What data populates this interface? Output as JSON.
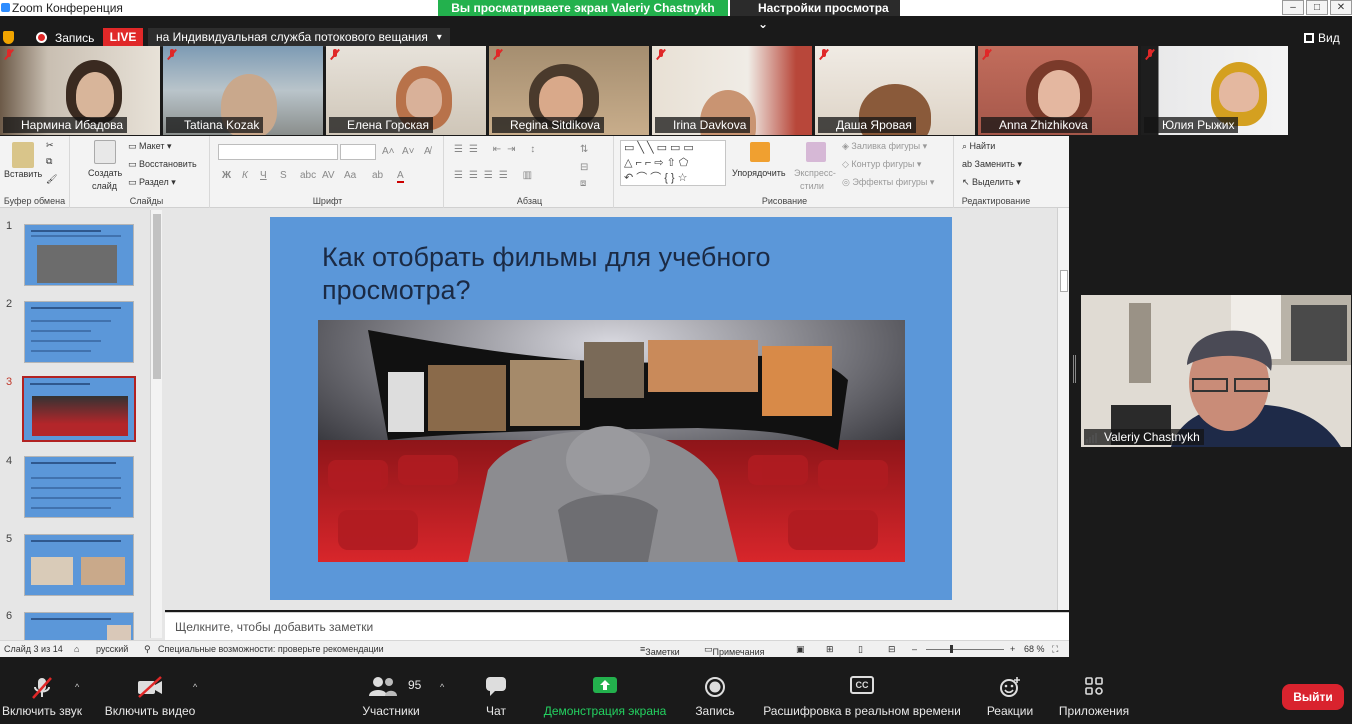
{
  "window": {
    "title": "Zoom Конференция",
    "share_banner": "Вы просматриваете экран Valeriy Chastnykh",
    "view_options": "Настройки просмотра"
  },
  "status": {
    "recording": "Запись",
    "live": "LIVE",
    "live_target": "на Индивидуальная служба потокового вещания",
    "view": "Вид"
  },
  "participants": [
    {
      "name": "Нармина Ибадова"
    },
    {
      "name": "Tatiana Kozak"
    },
    {
      "name": "Елена Горская"
    },
    {
      "name": "Regina Sitdikova"
    },
    {
      "name": "Irina Davkova"
    },
    {
      "name": "Даша Яровая"
    },
    {
      "name": "Anna Zhizhikova"
    },
    {
      "name": "Юлия Рыжих"
    }
  ],
  "active_speaker": {
    "name": "Valeriy Chastnykh"
  },
  "ribbon": {
    "groups": {
      "clipboard": "Буфер обмена",
      "slides": "Слайды",
      "font": "Шрифт",
      "paragraph": "Абзац",
      "drawing": "Рисование",
      "editing": "Редактирование"
    },
    "paste": "Вставить",
    "new_slide_1": "Создать",
    "new_slide_2": "слайд",
    "layout": "Макет",
    "reset": "Восстановить",
    "section": "Раздел",
    "arrange": "Упорядочить",
    "quick_styles_1": "Экспресс-",
    "quick_styles_2": "стили",
    "shape_fill": "Заливка фигуры",
    "shape_outline": "Контур фигуры",
    "shape_effects": "Эффекты фигуры",
    "find": "Найти",
    "replace": "Заменить",
    "select": "Выделить",
    "bold": "Ж",
    "italic": "К",
    "underline": "Ч",
    "strike": "S",
    "spacing": "AV",
    "case": "Aa",
    "font_color": "A"
  },
  "thumbnails": [
    {
      "num": "1"
    },
    {
      "num": "2"
    },
    {
      "num": "3"
    },
    {
      "num": "4"
    },
    {
      "num": "5"
    },
    {
      "num": "6"
    }
  ],
  "slide": {
    "title": "Как отобрать фильмы для учебного просмотра?"
  },
  "notes_placeholder": "Щелкните, чтобы добавить заметки",
  "ppt_status": {
    "slide_count": "Слайд 3 из 14",
    "language": "русский",
    "accessibility": "Специальные возможности: проверьте рекомендации",
    "notes": "Заметки",
    "comments": "Примечания",
    "zoom": "68 %"
  },
  "toolbar": {
    "mute": "Включить звук",
    "video": "Включить видео",
    "participants": "Участники",
    "participants_count": "95",
    "chat": "Чат",
    "share": "Демонстрация экрана",
    "record": "Запись",
    "captions": "Расшифровка в реальном времени",
    "captions_icon_text": "CC",
    "reactions": "Реакции",
    "apps": "Приложения",
    "leave": "Выйти"
  },
  "colors": {
    "share_green": "#23b14d",
    "live_red": "#e02828",
    "leave_red": "#d9232e",
    "slide_blue": "#5b97d9"
  }
}
